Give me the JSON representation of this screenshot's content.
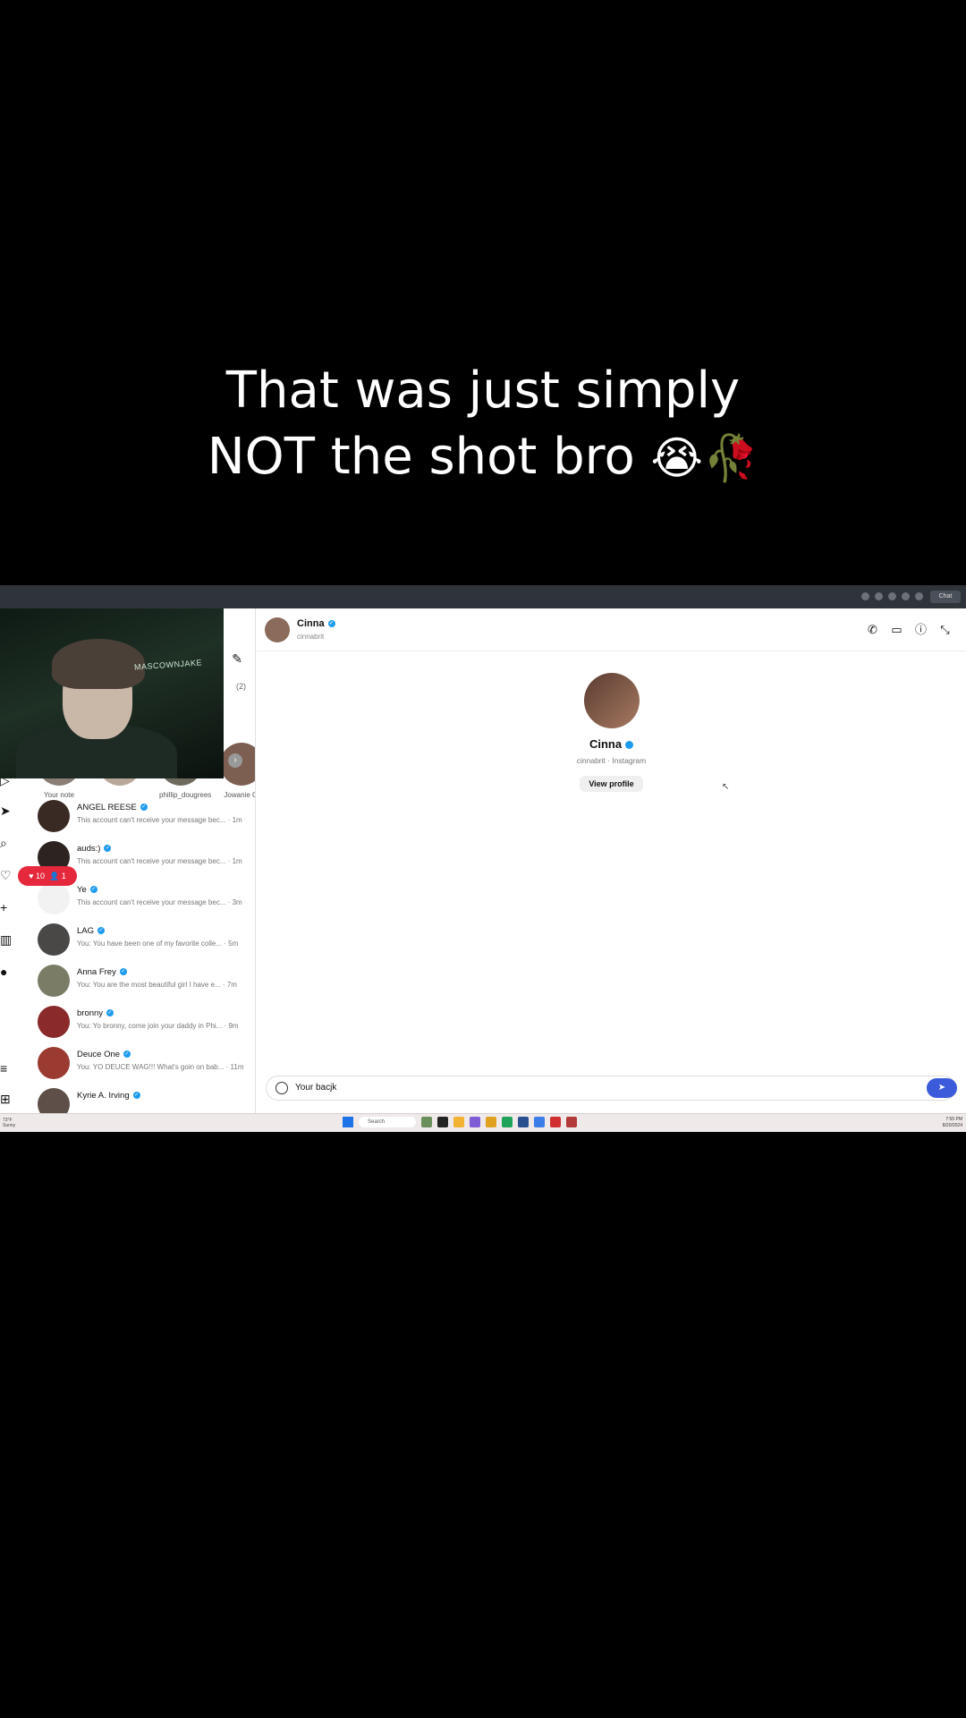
{
  "caption": {
    "line1": "That was just simply",
    "line2": "NOT the shot bro",
    "emoji": "😭🥀"
  },
  "browser": {
    "chat_tab": "Chat"
  },
  "dm_list": {
    "requests_label": "(2)",
    "notes": [
      {
        "name": "Your note"
      },
      {
        "name": ""
      },
      {
        "name": "phillip_dougrees"
      },
      {
        "name": "Jowanie Cl"
      }
    ],
    "threads": [
      {
        "name": "ANGEL REESE",
        "preview": "This account can't receive your message bec... · 1m"
      },
      {
        "name": "auds:)",
        "preview": "This account can't receive your message bec... · 1m"
      },
      {
        "name": "Ye",
        "preview": "This account can't receive your message bec... · 3m"
      },
      {
        "name": "LAG",
        "preview": "You: You have been one of my favorite colle... · 5m"
      },
      {
        "name": "Anna Frey",
        "preview": "You: You are the most beautiful girl I have e... · 7m"
      },
      {
        "name": "bronny",
        "preview": "You: Yo bronny, come join your daddy in Phi... · 9m"
      },
      {
        "name": "Deuce One",
        "preview": "You: YO DEUCE WAG!!! What's goin on bab... · 11m"
      },
      {
        "name": "Kyrie A. Irving",
        "preview": ""
      }
    ]
  },
  "notification": {
    "likes": "10",
    "follows": "1"
  },
  "webcam": {
    "sign_text": "MASCOWNJAKE"
  },
  "chat": {
    "header": {
      "name": "Cinna",
      "username": "cinnabrit"
    },
    "profile": {
      "name": "Cinna",
      "subtitle": "cinnabrit · Instagram",
      "view_profile_label": "View profile"
    },
    "composer": {
      "value": "Your bacjk"
    }
  },
  "taskbar": {
    "weather_temp": "73°F",
    "weather_desc": "Sunny",
    "search_label": "Search",
    "time": "7:55 PM",
    "date": "8/20/2024"
  },
  "colors": {
    "verified": "#1d9bf0",
    "send_button": "#3b5bdb",
    "notification": "#e5283c"
  }
}
